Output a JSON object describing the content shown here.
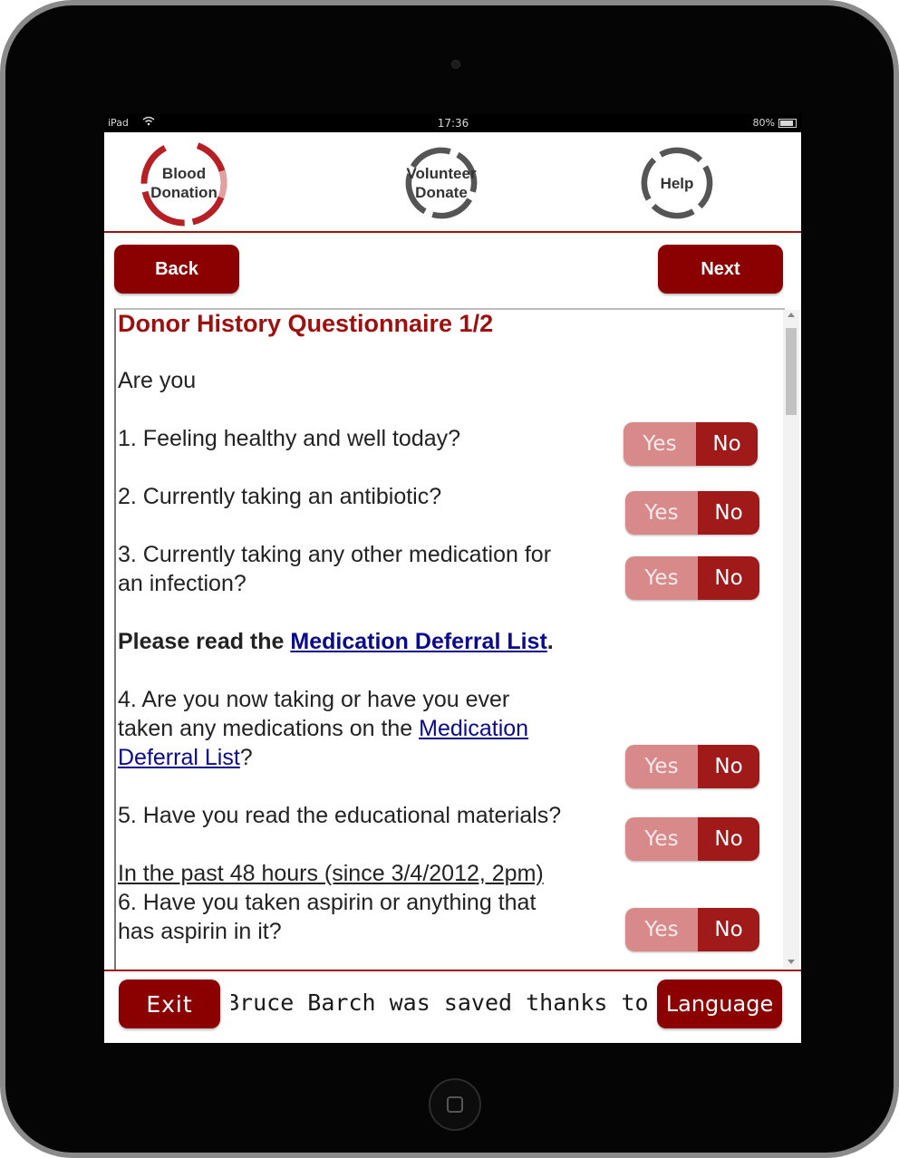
{
  "status_bar": {
    "carrier": "iPad",
    "time": "17:36",
    "battery": "80%"
  },
  "nav": {
    "blood_donation": "Blood\nDonation",
    "volunteer_donate": "Volunteer\nDonate",
    "help": "Help"
  },
  "toolbar": {
    "back_label": "Back",
    "next_label": "Next"
  },
  "questionnaire": {
    "title": "Donor History Questionnaire 1/2",
    "intro": "Are you",
    "q1": "1. Feeling healthy and well today?",
    "q2": "2. Currently taking an antibiotic?",
    "q3_line1": "3. Currently taking any other medication for",
    "q3_line2": "an infection?",
    "notice_prefix": "Please read the ",
    "notice_link": "Medication Deferral List",
    "notice_suffix": ".",
    "q4_line1": "4. Are you now taking or have you ever",
    "q4_line2_prefix": "taken any medications on the ",
    "q4_link_part1": "Medication",
    "q4_link_part2": "Deferral List",
    "q4_suffix": "?",
    "q5": "5. Have you read the educational materials?",
    "section_48h": "In the past 48 hours (since 3/4/2012, 2pm)",
    "q6_line1": "6. Have you taken aspirin or anything that",
    "q6_line2": "has aspirin in it?",
    "yes_label": "Yes",
    "no_label": "No"
  },
  "footer": {
    "exit_label": "Exit",
    "ticker": "Bruce Barch was saved thanks to yo",
    "language_label": "Language"
  },
  "colors": {
    "accent": "#8b0000",
    "title": "#9d1010",
    "toggle_yes": "#d88a8a",
    "toggle_no": "#a11a1a",
    "link": "#0a0a8a"
  }
}
